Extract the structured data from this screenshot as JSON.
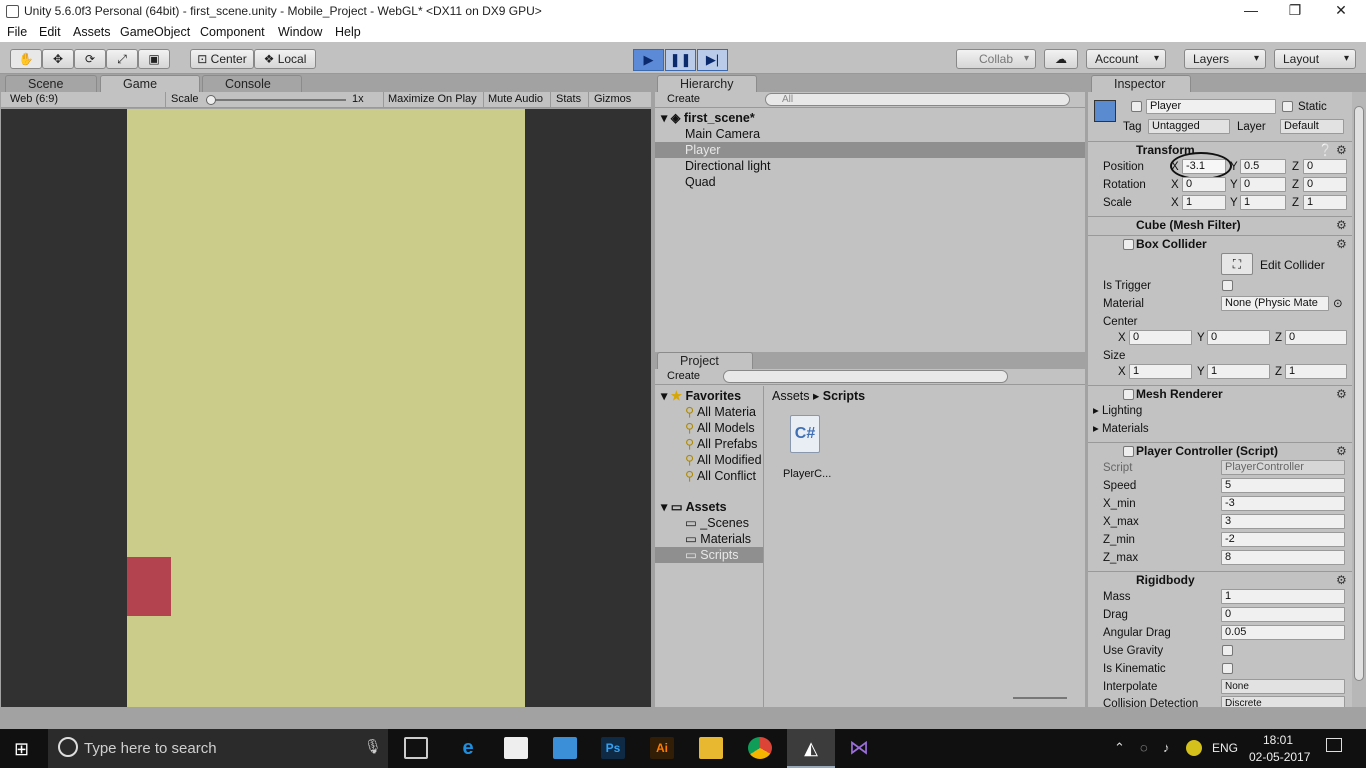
{
  "window": {
    "title": "Unity 5.6.0f3 Personal (64bit) - first_scene.unity - Mobile_Project - WebGL* <DX11 on DX9 GPU>",
    "minimize": "—",
    "maximize": "❐",
    "close": "✕"
  },
  "menu": [
    "File",
    "Edit",
    "Assets",
    "GameObject",
    "Component",
    "Window",
    "Help"
  ],
  "toolbar": {
    "center": "Center",
    "local": "Local",
    "collab": "Collab",
    "account": "Account",
    "layers": "Layers",
    "layout": "Layout"
  },
  "tabs": {
    "scene": "Scene",
    "game": "Game",
    "console": "Console",
    "hierarchy": "Hierarchy",
    "project": "Project",
    "inspector": "Inspector"
  },
  "game_bar": {
    "aspect": "Web (6:9)",
    "scale": "Scale",
    "scale_value": "1x",
    "maximize": "Maximize On Play",
    "mute": "Mute Audio",
    "stats": "Stats",
    "gizmos": "Gizmos",
    "scale_slider": 0.0
  },
  "hierarchy": {
    "create": "Create",
    "search_placeholder": "All",
    "scene": "first_scene*",
    "items": [
      "Main Camera",
      "Player",
      "Directional light",
      "Quad"
    ],
    "selected": "Player"
  },
  "project": {
    "create": "Create",
    "favorites_label": "Favorites",
    "favorites": [
      "All Materia",
      "All Models",
      "All Prefabs",
      "All Modified",
      "All Conflict"
    ],
    "assets_label": "Assets",
    "folders": [
      "_Scenes",
      "Materials",
      "Scripts"
    ],
    "selected_folder": "Scripts",
    "breadcrumb": [
      "Assets",
      "Scripts"
    ],
    "files": [
      {
        "name": "PlayerC...",
        "icon": "csharp-icon",
        "glyph": "C#"
      }
    ]
  },
  "inspector": {
    "name": "Player",
    "static": "Static",
    "tag_label": "Tag",
    "tag": "Untagged",
    "layer_label": "Layer",
    "layer": "Default",
    "transform": {
      "title": "Transform",
      "rows": [
        {
          "label": "Position",
          "x": "-3.1",
          "y": "0.5",
          "z": "0"
        },
        {
          "label": "Rotation",
          "x": "0",
          "y": "0",
          "z": "0"
        },
        {
          "label": "Scale",
          "x": "1",
          "y": "1",
          "z": "1"
        }
      ]
    },
    "mesh_filter": "Cube (Mesh Filter)",
    "box_collider": {
      "title": "Box Collider",
      "edit": "Edit Collider",
      "is_trigger": "Is Trigger",
      "material_label": "Material",
      "material": "None (Physic Mate",
      "center": "Center",
      "center_x": "0",
      "center_y": "0",
      "center_z": "0",
      "size": "Size",
      "size_x": "1",
      "size_y": "1",
      "size_z": "1"
    },
    "mesh_renderer": {
      "title": "Mesh Renderer",
      "lighting": "Lighting",
      "materials": "Materials"
    },
    "player_controller": {
      "title": "Player Controller (Script)",
      "script_label": "Script",
      "script": "PlayerController",
      "fields": [
        {
          "label": "Speed",
          "value": "5"
        },
        {
          "label": "X_min",
          "value": "-3"
        },
        {
          "label": "X_max",
          "value": "3"
        },
        {
          "label": "Z_min",
          "value": "-2"
        },
        {
          "label": "Z_max",
          "value": "8"
        }
      ]
    },
    "rigidbody": {
      "title": "Rigidbody",
      "fields": [
        {
          "label": "Mass",
          "value": "1"
        },
        {
          "label": "Drag",
          "value": "0"
        },
        {
          "label": "Angular Drag",
          "value": "0.05"
        }
      ],
      "use_gravity": "Use Gravity",
      "is_kinematic": "Is Kinematic",
      "interpolate_label": "Interpolate",
      "interpolate": "None",
      "collision_label": "Collision Detection",
      "collision": "Discrete"
    },
    "axis": {
      "x": "X",
      "y": "Y",
      "z": "Z"
    }
  },
  "taskbar": {
    "search": "Type here to search",
    "lang": "ENG",
    "time": "18:01",
    "date": "02-05-2017"
  },
  "colors": {
    "field": "#cccc8a",
    "player": "#b3434e",
    "game_bg": "#313131"
  }
}
